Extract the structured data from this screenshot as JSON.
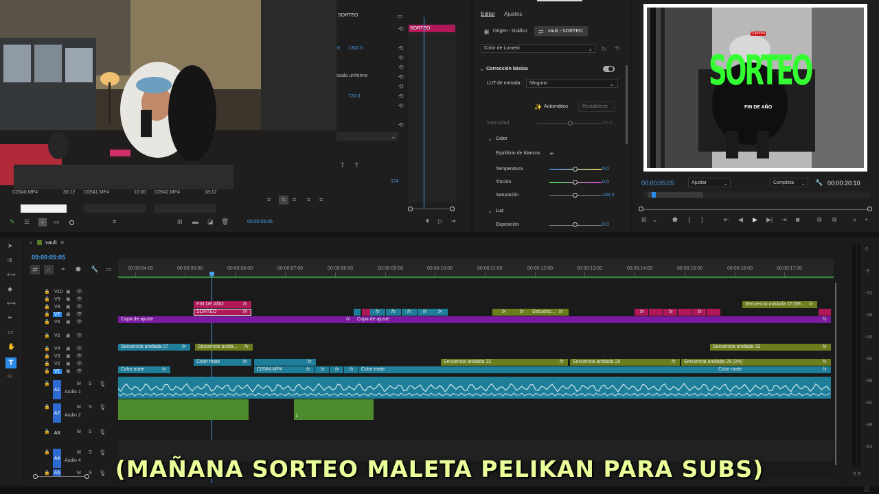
{
  "webcam": {
    "desc_label": ""
  },
  "project_bin": {
    "clips": [
      {
        "name": "C0540.MP4",
        "duration": "35:12"
      },
      {
        "name": "C0541.MP4",
        "duration": "10:00"
      },
      {
        "name": "C0542.MP4",
        "duration": "18:12"
      }
    ]
  },
  "effect_controls": {
    "tab": "SORTEO",
    "clip_label": "SORTEO",
    "values": [
      "1302.0",
      "720.0",
      "174"
    ],
    "uniform_scale": "scala uniforme",
    "left_partial": "0",
    "timecode": "00:00:05:05"
  },
  "lumetri": {
    "tabs": [
      "Editar",
      "Ajustes"
    ],
    "source_tabs": [
      "Origen - Gráfico",
      "vault - SORTEO"
    ],
    "effect_select": "Color de Lumetri",
    "section": "Corrección básica",
    "lut_label": "LUT de entrada",
    "lut_value": "Ninguno",
    "auto_label": "Automático",
    "reset_label": "Restablecer",
    "intensity_label": "Intensidad",
    "intensity_value": "50.0",
    "color_section": "Color",
    "wb_label": "Equilibrio de blancos",
    "temp_label": "Temperatura",
    "temp_value": "0.0",
    "tint_label": "Tinción",
    "tint_value": "0.0",
    "sat_label": "Saturación",
    "sat_value": "100.0",
    "light_section": "Luz",
    "exposure_label": "Exposición",
    "exposure_value": "0.0"
  },
  "program_monitor": {
    "title_text": "SORTEO",
    "subtitle_text": "FIN DE AÑO",
    "cap_logo": "Supreme",
    "current_time": "00:00:05:05",
    "fit_label": "Ajustar",
    "quality_label": "Completa",
    "duration": "00:00:20:10"
  },
  "timeline": {
    "sequence_name": "vault",
    "timecode": "00:00:05:05",
    "ruler": [
      "00:00:04:00",
      "00:00:05:00",
      "00:00:06:00",
      "00:00:07:00",
      "00:00:08:00",
      "00:00:09:00",
      "00:00:10:00",
      "00:00:11:00",
      "00:00:12:00",
      "00:00:13:00",
      "00:00:14:00",
      "00:00:15:00",
      "00:00:16:00",
      "00:00:17:00"
    ],
    "video_tracks": [
      "V10",
      "V9",
      "V8",
      "V7",
      "V6",
      "V5",
      "V4",
      "V3",
      "V2",
      "V1"
    ],
    "audio_tracks": [
      {
        "id": "A1",
        "name": "Audio 1"
      },
      {
        "id": "A2",
        "name": "Audio 2"
      },
      {
        "id": "A3",
        "name": ""
      },
      {
        "id": "A4",
        "name": "Audio 4"
      },
      {
        "id": "A5",
        "name": ""
      }
    ],
    "clips": {
      "fin_de_ano": "FIN DE AÑO",
      "sorteo": "SORTEO",
      "capa1": "Capa de ajuste",
      "capa2": "Capa de ajuste",
      "seq07": "Secuencia anidada 07",
      "seq_v4b": "Secuencia anida...",
      "seq33": "Secuencia anidada 33",
      "seq15": "Secuencia anidada 15 [69...",
      "secuenc": "Secuenc...",
      "color_mate_v2": "Color mate",
      "seq32": "Secuencia anidada 32",
      "seq28": "Secuencia anidada 28",
      "seq28b": "Secuencia anidada 28 [3%]",
      "color_mate_v1": "Color mate",
      "c0584": "C0584.MP4",
      "color_mate_v1b": "Color mate",
      "color_mate_v1c": "Color mate",
      "a2_marker": "1"
    },
    "track_buttons": {
      "mute": "M",
      "solo": "S"
    }
  },
  "meters": {
    "scale": [
      "0",
      "-6",
      "-12",
      "-18",
      "-24",
      "-30",
      "-36",
      "-42",
      "-48",
      "-54"
    ],
    "labels": "S S"
  },
  "caption": {
    "text": "(MAÑANA SORTEO MALETA PELIKAN PARA SUBS)"
  },
  "colors": {
    "accent_blue": "#2d8ceb",
    "magenta": "#b0185a",
    "purple": "#7a1aa0",
    "teal": "#1f7e9a",
    "olive": "#6b7d1c",
    "green_audio": "#4e8a2e",
    "caption_yellow": "#e8ff9a",
    "sorteo_green": "#33ff33"
  }
}
